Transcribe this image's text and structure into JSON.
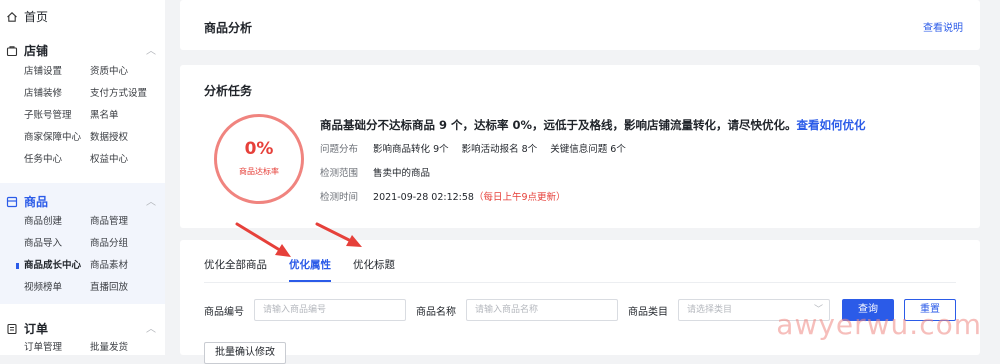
{
  "sidebar": {
    "home": "首页",
    "sections": [
      {
        "title": "店铺",
        "items": [
          "店铺设置",
          "资质中心",
          "店铺装修",
          "支付方式设置",
          "子账号管理",
          "黑名单",
          "商家保障中心",
          "数据授权",
          "任务中心",
          "权益中心"
        ]
      },
      {
        "title": "商品",
        "items": [
          "商品创建",
          "商品管理",
          "商品导入",
          "商品分组",
          "商品成长中心",
          "商品素材",
          "视频榜单",
          "直播回放"
        ]
      },
      {
        "title": "订单",
        "items": [
          "订单管理",
          "批量发货"
        ]
      }
    ]
  },
  "header": {
    "title": "商品分析",
    "help_link": "查看说明"
  },
  "task": {
    "title": "分析任务",
    "gauge_value": "0%",
    "gauge_label": "商品达标率",
    "summary": "商品基础分不达标商品 9 个，达标率 0%，远低于及格线，影响店铺流量转化，请尽快优化。",
    "summary_link": "查看如何优化",
    "problem_label": "问题分布",
    "problems": [
      "影响商品转化 9个",
      "影响活动报名 8个",
      "关键信息问题 6个"
    ],
    "scope_label": "检测范围",
    "scope_value": "售卖中的商品",
    "time_label": "检测时间",
    "time_value": "2021-09-28 02:12:58",
    "time_note": "（每日上午9点更新）"
  },
  "tabs": [
    "优化全部商品",
    "优化属性",
    "优化标题"
  ],
  "active_tab": 1,
  "filters": {
    "code_label": "商品编号",
    "code_placeholder": "请输入商品编号",
    "name_label": "商品名称",
    "name_placeholder": "请输入商品名称",
    "category_label": "商品类目",
    "category_placeholder": "请选择类目",
    "search_button": "查询",
    "reset_button": "重置"
  },
  "batch_button": "批量确认修改",
  "watermark": "awyerwu.com",
  "colors": {
    "accent": "#2b5be8",
    "danger": "#e6403a",
    "arrow": "#e6403a"
  }
}
